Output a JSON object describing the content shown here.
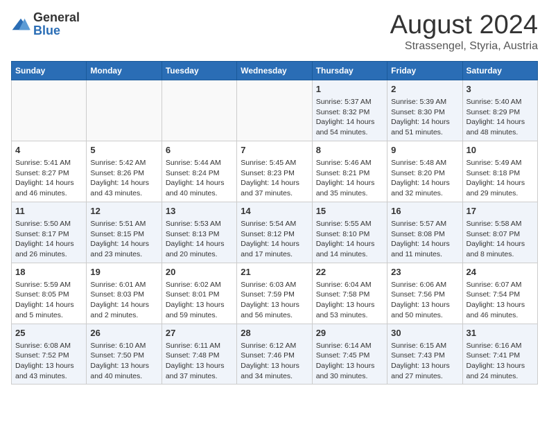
{
  "logo": {
    "text_general": "General",
    "text_blue": "Blue"
  },
  "title": "August 2024",
  "subtitle": "Strassengel, Styria, Austria",
  "days_of_week": [
    "Sunday",
    "Monday",
    "Tuesday",
    "Wednesday",
    "Thursday",
    "Friday",
    "Saturday"
  ],
  "weeks": [
    [
      {
        "day": "",
        "content": ""
      },
      {
        "day": "",
        "content": ""
      },
      {
        "day": "",
        "content": ""
      },
      {
        "day": "",
        "content": ""
      },
      {
        "day": "1",
        "content": "Sunrise: 5:37 AM\nSunset: 8:32 PM\nDaylight: 14 hours\nand 54 minutes."
      },
      {
        "day": "2",
        "content": "Sunrise: 5:39 AM\nSunset: 8:30 PM\nDaylight: 14 hours\nand 51 minutes."
      },
      {
        "day": "3",
        "content": "Sunrise: 5:40 AM\nSunset: 8:29 PM\nDaylight: 14 hours\nand 48 minutes."
      }
    ],
    [
      {
        "day": "4",
        "content": "Sunrise: 5:41 AM\nSunset: 8:27 PM\nDaylight: 14 hours\nand 46 minutes."
      },
      {
        "day": "5",
        "content": "Sunrise: 5:42 AM\nSunset: 8:26 PM\nDaylight: 14 hours\nand 43 minutes."
      },
      {
        "day": "6",
        "content": "Sunrise: 5:44 AM\nSunset: 8:24 PM\nDaylight: 14 hours\nand 40 minutes."
      },
      {
        "day": "7",
        "content": "Sunrise: 5:45 AM\nSunset: 8:23 PM\nDaylight: 14 hours\nand 37 minutes."
      },
      {
        "day": "8",
        "content": "Sunrise: 5:46 AM\nSunset: 8:21 PM\nDaylight: 14 hours\nand 35 minutes."
      },
      {
        "day": "9",
        "content": "Sunrise: 5:48 AM\nSunset: 8:20 PM\nDaylight: 14 hours\nand 32 minutes."
      },
      {
        "day": "10",
        "content": "Sunrise: 5:49 AM\nSunset: 8:18 PM\nDaylight: 14 hours\nand 29 minutes."
      }
    ],
    [
      {
        "day": "11",
        "content": "Sunrise: 5:50 AM\nSunset: 8:17 PM\nDaylight: 14 hours\nand 26 minutes."
      },
      {
        "day": "12",
        "content": "Sunrise: 5:51 AM\nSunset: 8:15 PM\nDaylight: 14 hours\nand 23 minutes."
      },
      {
        "day": "13",
        "content": "Sunrise: 5:53 AM\nSunset: 8:13 PM\nDaylight: 14 hours\nand 20 minutes."
      },
      {
        "day": "14",
        "content": "Sunrise: 5:54 AM\nSunset: 8:12 PM\nDaylight: 14 hours\nand 17 minutes."
      },
      {
        "day": "15",
        "content": "Sunrise: 5:55 AM\nSunset: 8:10 PM\nDaylight: 14 hours\nand 14 minutes."
      },
      {
        "day": "16",
        "content": "Sunrise: 5:57 AM\nSunset: 8:08 PM\nDaylight: 14 hours\nand 11 minutes."
      },
      {
        "day": "17",
        "content": "Sunrise: 5:58 AM\nSunset: 8:07 PM\nDaylight: 14 hours\nand 8 minutes."
      }
    ],
    [
      {
        "day": "18",
        "content": "Sunrise: 5:59 AM\nSunset: 8:05 PM\nDaylight: 14 hours\nand 5 minutes."
      },
      {
        "day": "19",
        "content": "Sunrise: 6:01 AM\nSunset: 8:03 PM\nDaylight: 14 hours\nand 2 minutes."
      },
      {
        "day": "20",
        "content": "Sunrise: 6:02 AM\nSunset: 8:01 PM\nDaylight: 13 hours\nand 59 minutes."
      },
      {
        "day": "21",
        "content": "Sunrise: 6:03 AM\nSunset: 7:59 PM\nDaylight: 13 hours\nand 56 minutes."
      },
      {
        "day": "22",
        "content": "Sunrise: 6:04 AM\nSunset: 7:58 PM\nDaylight: 13 hours\nand 53 minutes."
      },
      {
        "day": "23",
        "content": "Sunrise: 6:06 AM\nSunset: 7:56 PM\nDaylight: 13 hours\nand 50 minutes."
      },
      {
        "day": "24",
        "content": "Sunrise: 6:07 AM\nSunset: 7:54 PM\nDaylight: 13 hours\nand 46 minutes."
      }
    ],
    [
      {
        "day": "25",
        "content": "Sunrise: 6:08 AM\nSunset: 7:52 PM\nDaylight: 13 hours\nand 43 minutes."
      },
      {
        "day": "26",
        "content": "Sunrise: 6:10 AM\nSunset: 7:50 PM\nDaylight: 13 hours\nand 40 minutes."
      },
      {
        "day": "27",
        "content": "Sunrise: 6:11 AM\nSunset: 7:48 PM\nDaylight: 13 hours\nand 37 minutes."
      },
      {
        "day": "28",
        "content": "Sunrise: 6:12 AM\nSunset: 7:46 PM\nDaylight: 13 hours\nand 34 minutes."
      },
      {
        "day": "29",
        "content": "Sunrise: 6:14 AM\nSunset: 7:45 PM\nDaylight: 13 hours\nand 30 minutes."
      },
      {
        "day": "30",
        "content": "Sunrise: 6:15 AM\nSunset: 7:43 PM\nDaylight: 13 hours\nand 27 minutes."
      },
      {
        "day": "31",
        "content": "Sunrise: 6:16 AM\nSunset: 7:41 PM\nDaylight: 13 hours\nand 24 minutes."
      }
    ]
  ]
}
